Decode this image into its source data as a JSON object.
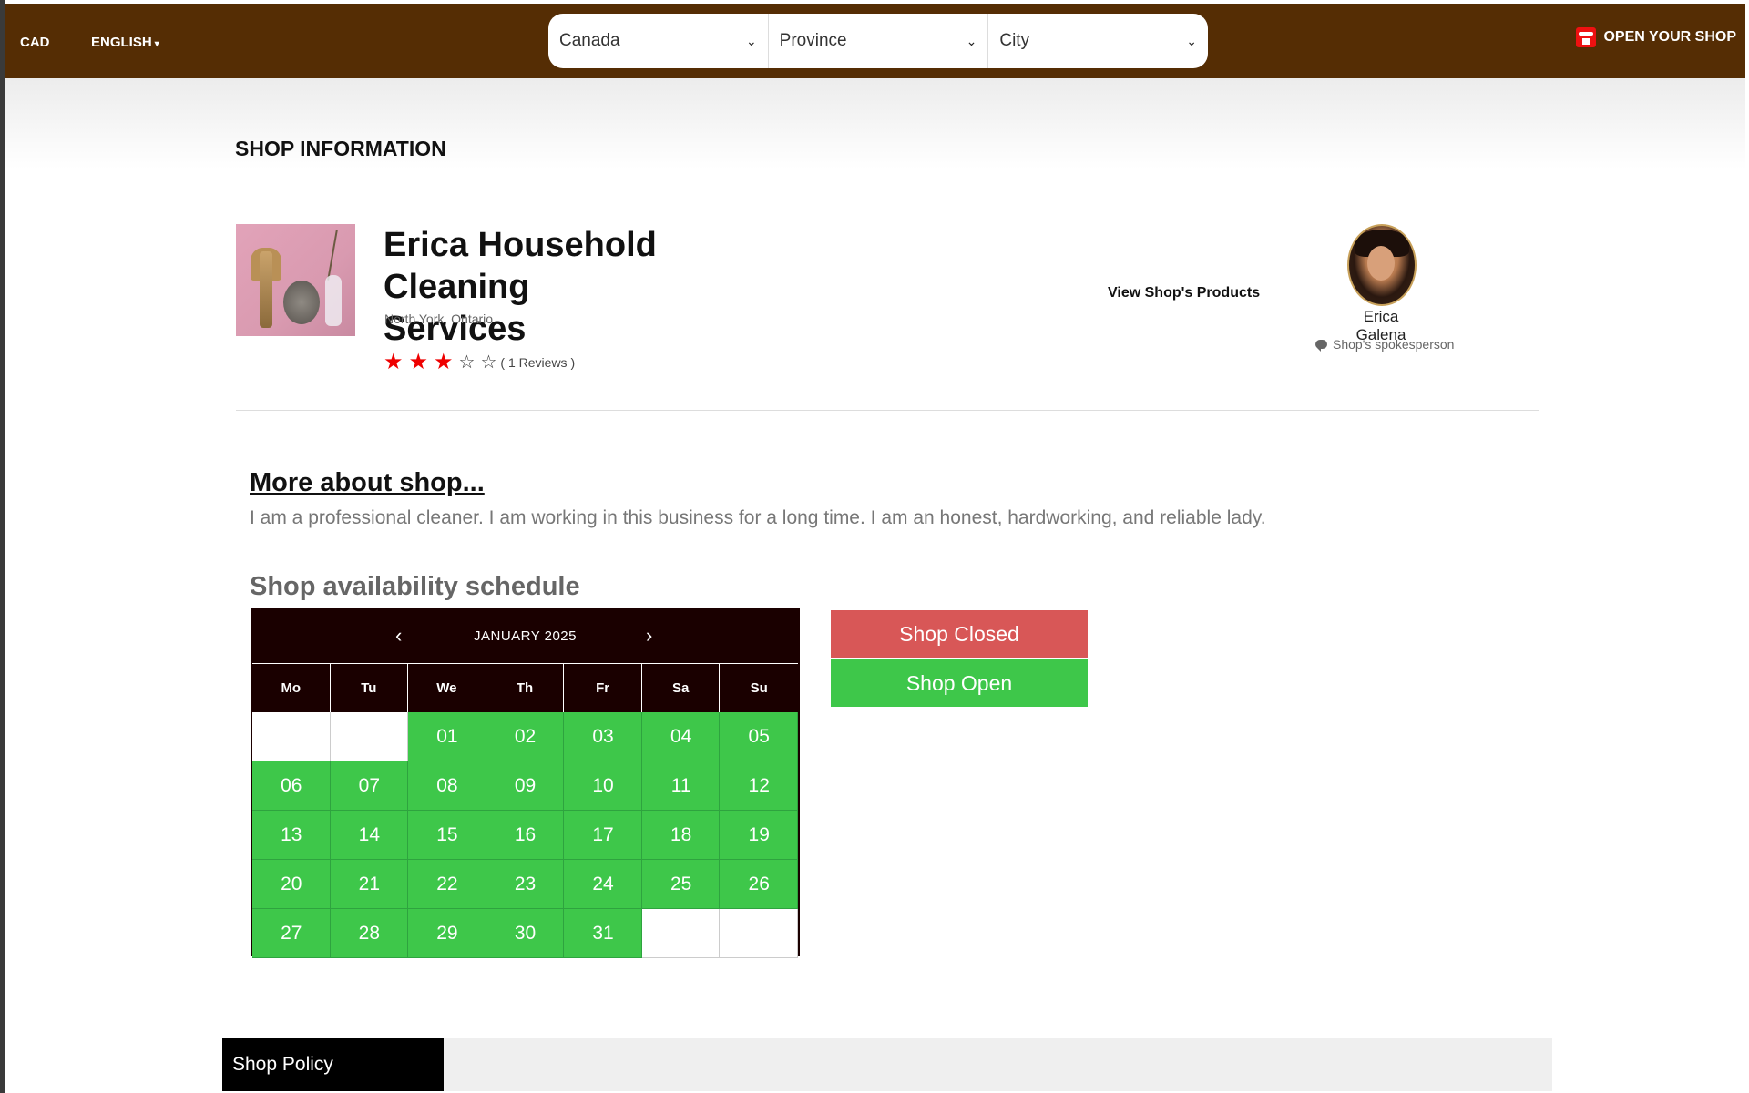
{
  "header": {
    "currency": "CAD",
    "language": "ENGLISH",
    "country": "Canada",
    "province": "Province",
    "city": "City",
    "open_shop": "OPEN YOUR SHOP"
  },
  "page": {
    "section_title": "SHOP INFORMATION"
  },
  "shop": {
    "name": "Erica Household Cleaning Services",
    "location": "North York, Ontario",
    "rating": 3,
    "max_rating": 5,
    "reviews_text": "( 1 Reviews )",
    "view_products": "View Shop's Products"
  },
  "spokesperson": {
    "name": "Erica Galena",
    "role": "Shop's spokesperson"
  },
  "about": {
    "title": "More about shop...",
    "description": "I am a professional cleaner. I am working in this business for a long time. I am an honest, hardworking, and reliable lady."
  },
  "schedule": {
    "title": "Shop availability schedule",
    "month": "JANUARY 2025",
    "weekdays": [
      "Mo",
      "Tu",
      "We",
      "Th",
      "Fr",
      "Sa",
      "Su"
    ],
    "days": [
      "",
      "",
      "01",
      "02",
      "03",
      "04",
      "05",
      "06",
      "07",
      "08",
      "09",
      "10",
      "11",
      "12",
      "13",
      "14",
      "15",
      "16",
      "17",
      "18",
      "19",
      "20",
      "21",
      "22",
      "23",
      "24",
      "25",
      "26",
      "27",
      "28",
      "29",
      "30",
      "31",
      "",
      ""
    ],
    "legend_closed": "Shop Closed",
    "legend_open": "Shop Open",
    "colors": {
      "open": "#3ec74a",
      "closed": "#d85757",
      "header": "#1a0000"
    }
  },
  "tabs": {
    "policy": "Shop Policy"
  },
  "colors": {
    "topbar": "#552d04",
    "star": "#e00000"
  }
}
